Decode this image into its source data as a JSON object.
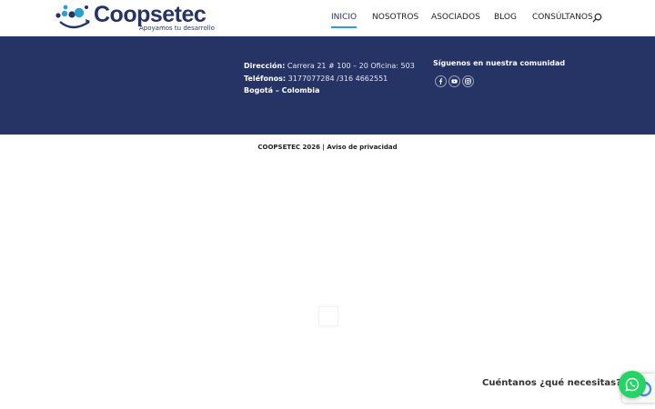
{
  "header": {
    "logo": {
      "name": "Coopsetec",
      "tagline": "Apoyamos tu desarrollo"
    },
    "nav": [
      {
        "label": "INICIO",
        "active": true
      },
      {
        "label": "NOSOTROS",
        "active": false
      },
      {
        "label": "ASOCIADOS",
        "active": false
      },
      {
        "label": "BLOG",
        "active": false
      },
      {
        "label": "CONSÚLTANOS",
        "active": false
      }
    ],
    "search_icon": "search-icon"
  },
  "footer": {
    "address": {
      "direccion_label": "Dirección:",
      "direccion_value": "Carrera 21 # 100 – 20 Oficina: 503",
      "telefonos_label": "Teléfonos:",
      "telefonos_value": "3177077284 /316 4662551",
      "city": "Bogotá – Colombia"
    },
    "social": {
      "title": "Síguenos en nuestra comunidad",
      "icons": [
        "facebook-icon",
        "youtube-icon",
        "instagram-icon"
      ]
    }
  },
  "copyright": {
    "brand": "COOPSETEC 2026",
    "separator": " | ",
    "privacy": "Aviso de privacidad"
  },
  "chat": {
    "label": "Cuéntanos ¿qué necesitas?",
    "icon": "whatsapp-icon"
  },
  "colors": {
    "brand_navy": "#253465",
    "accent_blue": "#2ba0cf",
    "whatsapp_green": "#25d366"
  }
}
